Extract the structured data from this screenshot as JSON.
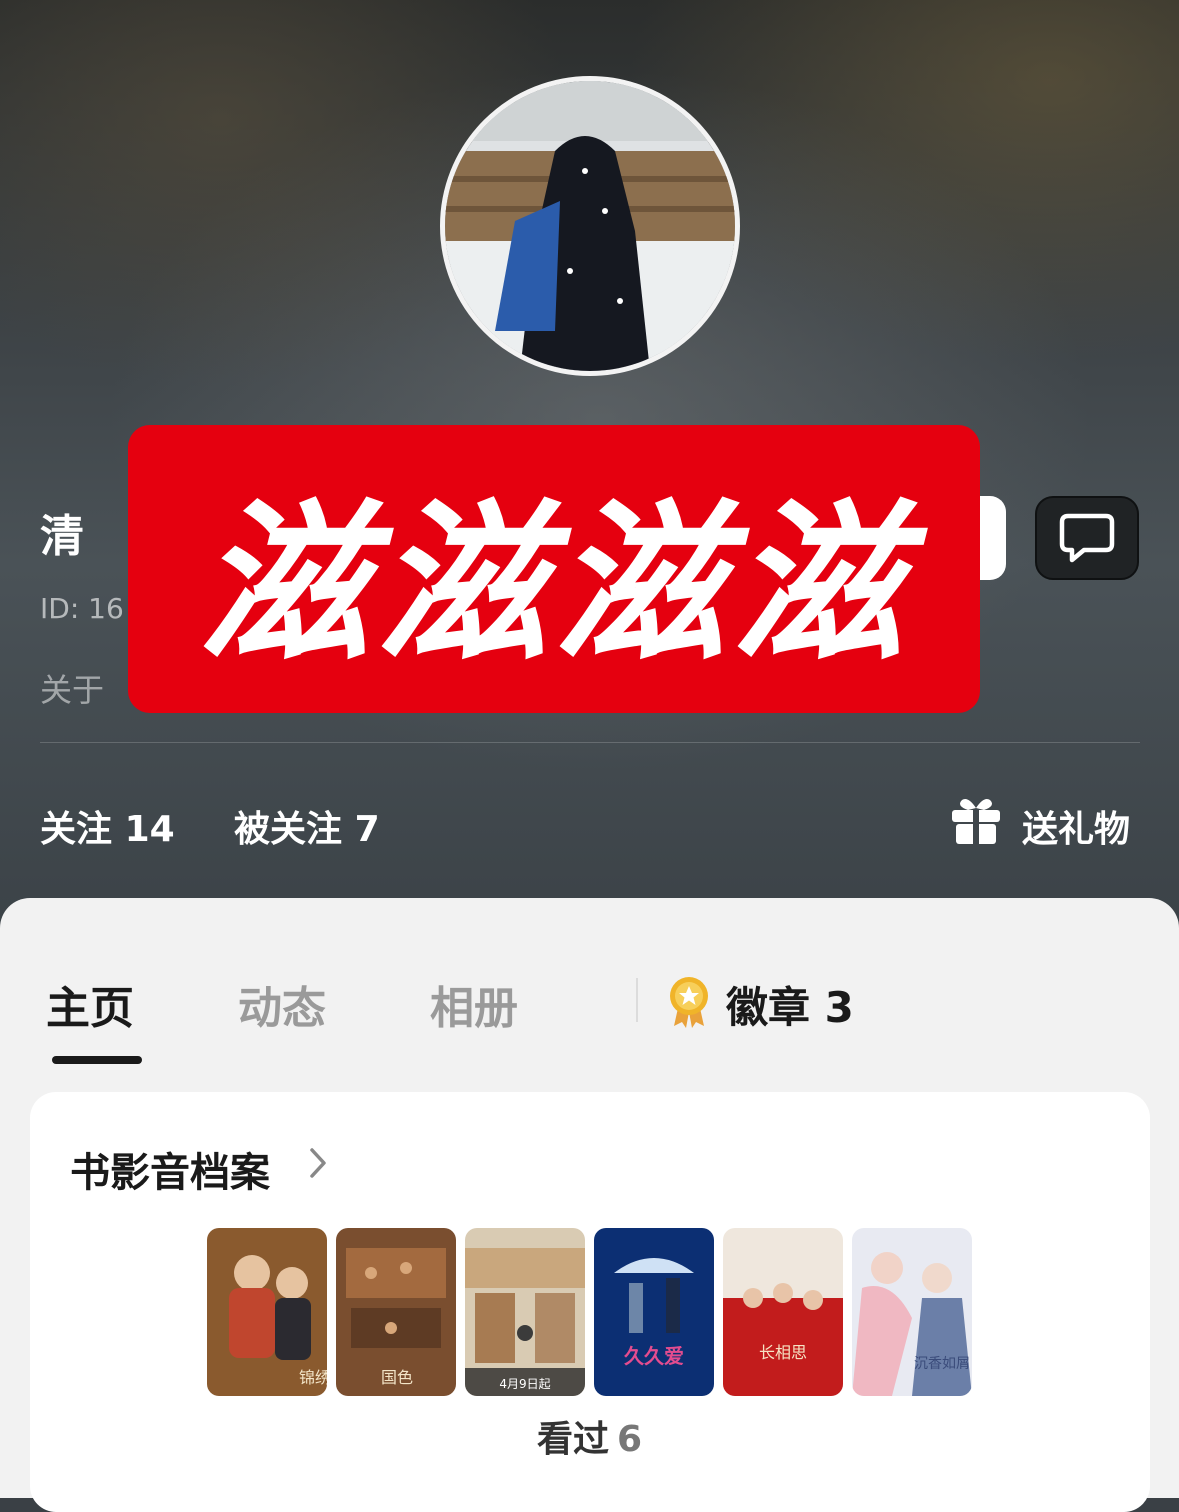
{
  "profile": {
    "name": "清",
    "id_text": "ID: 16",
    "bio": "关于",
    "censor_text": "滋滋滋滋"
  },
  "stats": {
    "following_label": "关注",
    "following_count": "14",
    "followers_label": "被关注",
    "followers_count": "7",
    "gift_label": "送礼物"
  },
  "tabs": [
    {
      "label": "主页"
    },
    {
      "label": "动态"
    },
    {
      "label": "相册"
    }
  ],
  "badge": {
    "label": "徽章",
    "count": "3"
  },
  "archive": {
    "title": "书影音档案",
    "watched_label": "看过",
    "watched_count": "6",
    "poster_texts": [
      "锦绣",
      "国色",
      "4月9日起",
      "久久爱",
      "长相思",
      "沉香如屑"
    ]
  },
  "icons": {
    "message": "chat-bubble-icon",
    "gift": "gift-icon",
    "badge": "medal-icon",
    "chevron": "chevron-right-icon"
  },
  "colors": {
    "censor": "#e5000f",
    "badge_gold": "#f0b429"
  }
}
